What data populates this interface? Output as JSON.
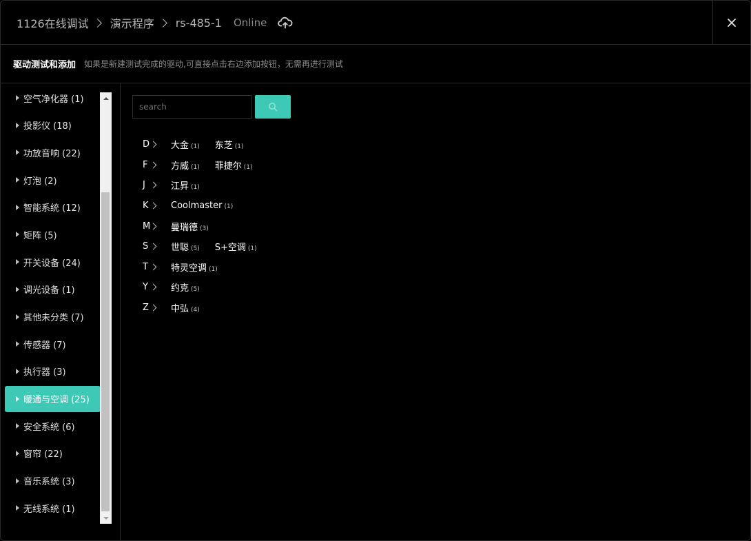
{
  "header": {
    "breadcrumb": [
      "1126在线调试",
      "演示程序",
      "rs-485-1"
    ],
    "status": "Online"
  },
  "subheader": {
    "title": "驱动测试和添加",
    "hint": "如果是新建测试完成的驱动,可直接点击右边添加按钮，无需再进行测试"
  },
  "categories": [
    {
      "label": "空气净化器 (1)"
    },
    {
      "label": "投影仪 (18)"
    },
    {
      "label": "功放音响 (22)"
    },
    {
      "label": "灯泡 (2)"
    },
    {
      "label": "智能系统 (12)"
    },
    {
      "label": "矩阵 (5)"
    },
    {
      "label": "开关设备 (24)"
    },
    {
      "label": "调光设备 (1)"
    },
    {
      "label": "其他未分类 (7)"
    },
    {
      "label": "传感器 (7)"
    },
    {
      "label": "执行器 (3)"
    },
    {
      "label": "暖通与空调 (25)",
      "active": true
    },
    {
      "label": "安全系统 (6)"
    },
    {
      "label": "窗帘 (22)"
    },
    {
      "label": "音乐系统 (3)"
    },
    {
      "label": "无线系统 (1)"
    }
  ],
  "search": {
    "placeholder": "search"
  },
  "groups": [
    {
      "letter": "D",
      "brands": [
        {
          "name": "大金",
          "count": "(1)"
        },
        {
          "name": "东芝",
          "count": "(1)"
        }
      ]
    },
    {
      "letter": "F",
      "brands": [
        {
          "name": "方威",
          "count": "(1)"
        },
        {
          "name": "菲捷尔",
          "count": "(1)"
        }
      ]
    },
    {
      "letter": "J",
      "brands": [
        {
          "name": "江昇",
          "count": "(1)"
        }
      ]
    },
    {
      "letter": "K",
      "brands": [
        {
          "name": "Coolmaster",
          "count": "(1)"
        }
      ]
    },
    {
      "letter": "M",
      "brands": [
        {
          "name": "曼瑞德",
          "count": "(3)"
        }
      ]
    },
    {
      "letter": "S",
      "brands": [
        {
          "name": "世聪",
          "count": "(5)"
        },
        {
          "name": "S+空调",
          "count": "(1)"
        }
      ]
    },
    {
      "letter": "T",
      "brands": [
        {
          "name": "特灵空调",
          "count": "(1)"
        }
      ]
    },
    {
      "letter": "Y",
      "brands": [
        {
          "name": "约克",
          "count": "(5)"
        }
      ]
    },
    {
      "letter": "Z",
      "brands": [
        {
          "name": "中弘",
          "count": "(4)"
        }
      ]
    }
  ],
  "colors": {
    "accent": "#3ec9b6",
    "background": "#000000"
  },
  "icons": {
    "cloud": "cloud-sync-icon",
    "close": "close-icon",
    "search": "search-icon"
  }
}
